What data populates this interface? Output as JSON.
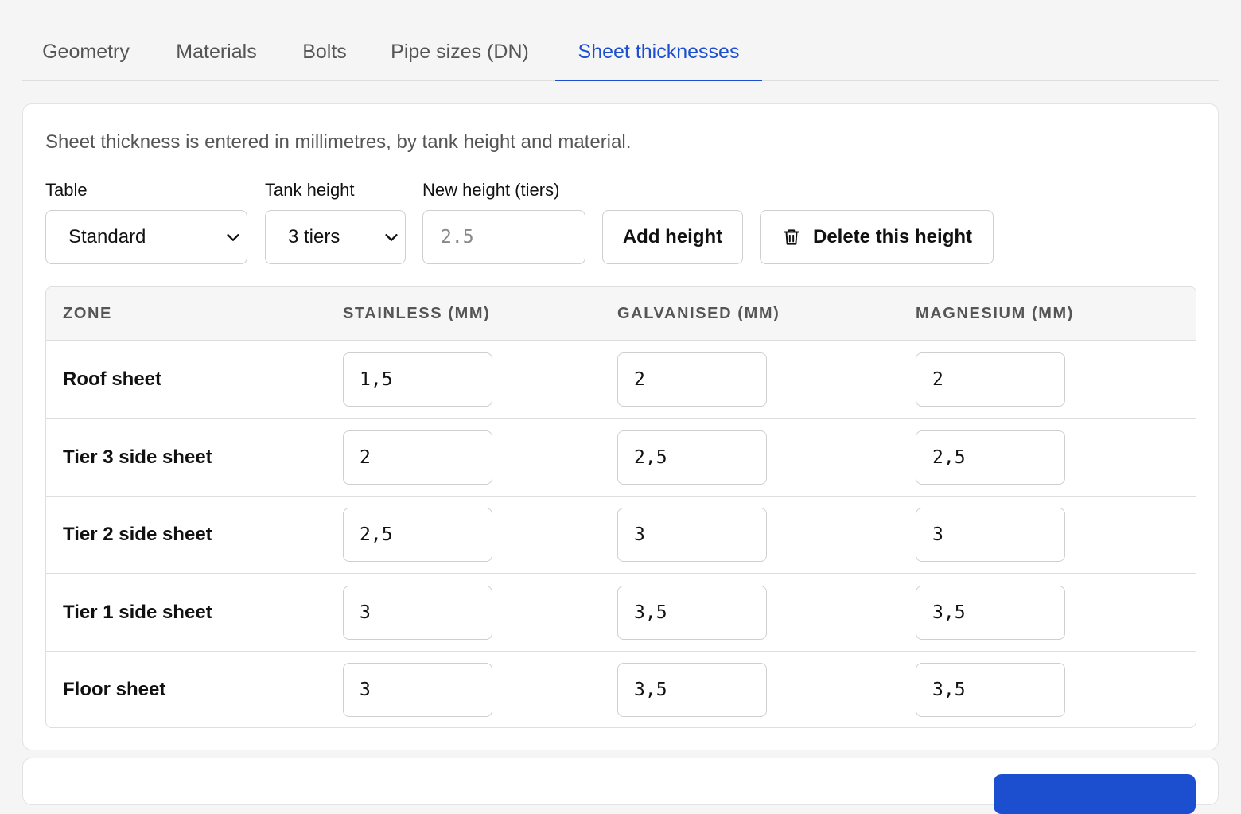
{
  "tabs": [
    "Geometry",
    "Materials",
    "Bolts",
    "Pipe sizes (DN)",
    "Sheet thicknesses"
  ],
  "active_tab": "Sheet thicknesses",
  "description": "Sheet thickness is entered in millimetres, by tank height and material.",
  "controls": {
    "table_label": "Table",
    "table_value": "Standard",
    "tank_height_label": "Tank height",
    "tank_height_value": "3 tiers",
    "new_height_label": "New height (tiers)",
    "new_height_placeholder": "2.5",
    "add_height_button": "Add height",
    "delete_height_button": "Delete this height"
  },
  "table": {
    "headers": [
      "ZONE",
      "STAINLESS (MM)",
      "GALVANISED (MM)",
      "MAGNESIUM (MM)"
    ],
    "rows": [
      {
        "zone": "Roof sheet",
        "stainless": "1,5",
        "galvanised": "2",
        "magnesium": "2"
      },
      {
        "zone": "Tier 3 side sheet",
        "stainless": "2",
        "galvanised": "2,5",
        "magnesium": "2,5"
      },
      {
        "zone": "Tier 2 side sheet",
        "stainless": "2,5",
        "galvanised": "3",
        "magnesium": "3"
      },
      {
        "zone": "Tier 1 side sheet",
        "stainless": "3",
        "galvanised": "3,5",
        "magnesium": "3,5"
      },
      {
        "zone": "Floor sheet",
        "stainless": "3",
        "galvanised": "3,5",
        "magnesium": "3,5"
      }
    ]
  },
  "colors": {
    "accent": "#1c4fd0",
    "border": "#dedede",
    "muted_text": "#555555"
  },
  "icons": {
    "select_arrow": "chevron-down-icon",
    "delete": "trash-icon"
  }
}
